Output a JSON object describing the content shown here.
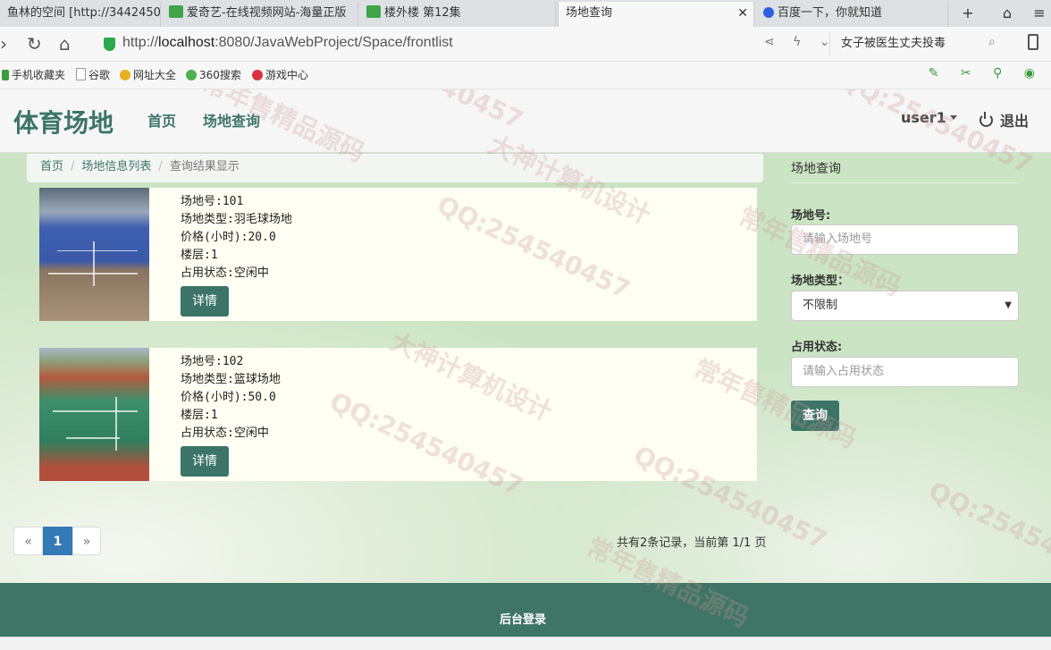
{
  "browser": {
    "tabs": [
      {
        "label": "鱼林的空间 [http://3442450"
      },
      {
        "label": "爱奇艺-在线视频网站-海量正版"
      },
      {
        "label": "楼外楼 第12集"
      },
      {
        "label": "场地查询"
      },
      {
        "label": "百度一下，你就知道"
      }
    ],
    "url_host": "localhost",
    "url_rest": ":8080/JavaWebProject/Space/frontlist",
    "url_scheme": "http://",
    "search_text": "女子被医生丈夫投毒",
    "bookmarks": [
      "手机收藏夹",
      "谷歌",
      "网址大全",
      "360搜索",
      "游戏中心"
    ]
  },
  "site": {
    "brand": "体育场地",
    "nav": [
      "首页",
      "场地查询"
    ],
    "user": "user1",
    "logout": "退出"
  },
  "breadcrumb": [
    "首页",
    "场地信息列表",
    "查询结果显示"
  ],
  "venues": [
    {
      "lines": [
        "场地号:101",
        "场地类型:羽毛球场地",
        "价格(小时):20.0",
        "楼层:1",
        "占用状态:空闲中"
      ],
      "detail": "详情",
      "photo_icon": "badminton-court-photo"
    },
    {
      "lines": [
        "场地号:102",
        "场地类型:篮球场地",
        "价格(小时):50.0",
        "楼层:1",
        "占用状态:空闲中"
      ],
      "detail": "详情",
      "photo_icon": "basketball-court-photo"
    }
  ],
  "pagination": {
    "prev": "«",
    "current": "1",
    "next": "»",
    "summary": "共有2条记录，当前第 1/1 页"
  },
  "query_panel": {
    "title": "场地查询",
    "field_number_label": "场地号:",
    "field_number_placeholder": "请输入场地号",
    "field_type_label": "场地类型：",
    "field_type_value": "不限制",
    "field_status_label": "占用状态:",
    "field_status_placeholder": "请输入占用状态",
    "submit": "查询"
  },
  "footer": {
    "admin_login": "后台登录"
  },
  "watermarks": [
    "QQ:254540457",
    "常年售精品源码",
    "大神计算机设计"
  ],
  "colors": {
    "primary": "#3c7567",
    "page_bg": "#cbe4c3",
    "card_bg": "#fefef2",
    "pager_active": "#337ab7"
  }
}
